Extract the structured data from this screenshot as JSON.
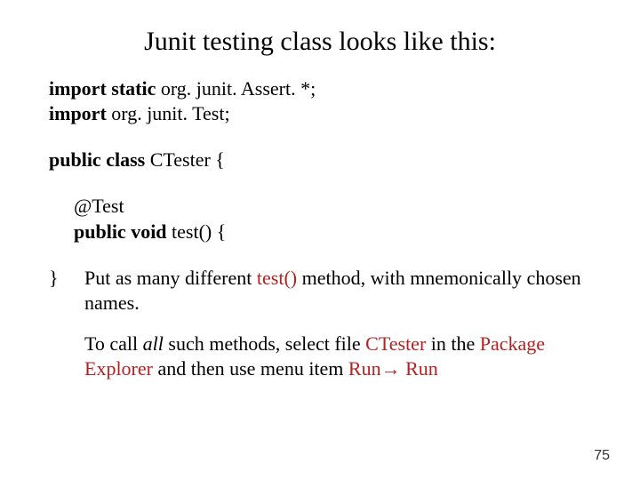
{
  "title": "Junit testing class looks like this:",
  "code": {
    "kw_import_static": "import static",
    "import_static_rest": " org. junit. Assert. *;",
    "kw_import": "import",
    "import_rest": " org. junit. Test;",
    "kw_public_class": "public class",
    "class_rest": " CTester {",
    "annotation": "@Test",
    "kw_public_void": "public void",
    "method_rest": " test() {",
    "close_brace": "}"
  },
  "notes": {
    "p1_a": "Put as many different ",
    "p1_test": "test()",
    "p1_b": " method, with mnemonically chosen names.",
    "p2_a": "To call ",
    "p2_all": "all",
    "p2_b": " such methods,  select file ",
    "p2_ctester": "CTester",
    "p2_c": " in the ",
    "p2_pkg": "Package Explorer",
    "p2_d": " and then use menu item ",
    "p2_run1": "Run",
    "p2_arrow": "→",
    "p2_run2": " Run"
  },
  "page_number": "75"
}
